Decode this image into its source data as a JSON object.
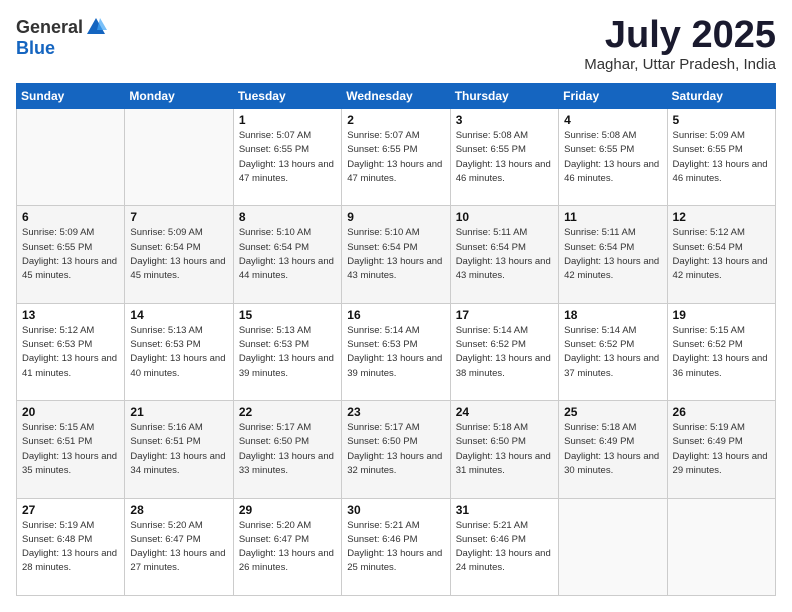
{
  "logo": {
    "general": "General",
    "blue": "Blue"
  },
  "title": "July 2025",
  "location": "Maghar, Uttar Pradesh, India",
  "headers": [
    "Sunday",
    "Monday",
    "Tuesday",
    "Wednesday",
    "Thursday",
    "Friday",
    "Saturday"
  ],
  "weeks": [
    [
      {
        "day": "",
        "sunrise": "",
        "sunset": "",
        "daylight": ""
      },
      {
        "day": "",
        "sunrise": "",
        "sunset": "",
        "daylight": ""
      },
      {
        "day": "1",
        "sunrise": "Sunrise: 5:07 AM",
        "sunset": "Sunset: 6:55 PM",
        "daylight": "Daylight: 13 hours and 47 minutes."
      },
      {
        "day": "2",
        "sunrise": "Sunrise: 5:07 AM",
        "sunset": "Sunset: 6:55 PM",
        "daylight": "Daylight: 13 hours and 47 minutes."
      },
      {
        "day": "3",
        "sunrise": "Sunrise: 5:08 AM",
        "sunset": "Sunset: 6:55 PM",
        "daylight": "Daylight: 13 hours and 46 minutes."
      },
      {
        "day": "4",
        "sunrise": "Sunrise: 5:08 AM",
        "sunset": "Sunset: 6:55 PM",
        "daylight": "Daylight: 13 hours and 46 minutes."
      },
      {
        "day": "5",
        "sunrise": "Sunrise: 5:09 AM",
        "sunset": "Sunset: 6:55 PM",
        "daylight": "Daylight: 13 hours and 46 minutes."
      }
    ],
    [
      {
        "day": "6",
        "sunrise": "Sunrise: 5:09 AM",
        "sunset": "Sunset: 6:55 PM",
        "daylight": "Daylight: 13 hours and 45 minutes."
      },
      {
        "day": "7",
        "sunrise": "Sunrise: 5:09 AM",
        "sunset": "Sunset: 6:54 PM",
        "daylight": "Daylight: 13 hours and 45 minutes."
      },
      {
        "day": "8",
        "sunrise": "Sunrise: 5:10 AM",
        "sunset": "Sunset: 6:54 PM",
        "daylight": "Daylight: 13 hours and 44 minutes."
      },
      {
        "day": "9",
        "sunrise": "Sunrise: 5:10 AM",
        "sunset": "Sunset: 6:54 PM",
        "daylight": "Daylight: 13 hours and 43 minutes."
      },
      {
        "day": "10",
        "sunrise": "Sunrise: 5:11 AM",
        "sunset": "Sunset: 6:54 PM",
        "daylight": "Daylight: 13 hours and 43 minutes."
      },
      {
        "day": "11",
        "sunrise": "Sunrise: 5:11 AM",
        "sunset": "Sunset: 6:54 PM",
        "daylight": "Daylight: 13 hours and 42 minutes."
      },
      {
        "day": "12",
        "sunrise": "Sunrise: 5:12 AM",
        "sunset": "Sunset: 6:54 PM",
        "daylight": "Daylight: 13 hours and 42 minutes."
      }
    ],
    [
      {
        "day": "13",
        "sunrise": "Sunrise: 5:12 AM",
        "sunset": "Sunset: 6:53 PM",
        "daylight": "Daylight: 13 hours and 41 minutes."
      },
      {
        "day": "14",
        "sunrise": "Sunrise: 5:13 AM",
        "sunset": "Sunset: 6:53 PM",
        "daylight": "Daylight: 13 hours and 40 minutes."
      },
      {
        "day": "15",
        "sunrise": "Sunrise: 5:13 AM",
        "sunset": "Sunset: 6:53 PM",
        "daylight": "Daylight: 13 hours and 39 minutes."
      },
      {
        "day": "16",
        "sunrise": "Sunrise: 5:14 AM",
        "sunset": "Sunset: 6:53 PM",
        "daylight": "Daylight: 13 hours and 39 minutes."
      },
      {
        "day": "17",
        "sunrise": "Sunrise: 5:14 AM",
        "sunset": "Sunset: 6:52 PM",
        "daylight": "Daylight: 13 hours and 38 minutes."
      },
      {
        "day": "18",
        "sunrise": "Sunrise: 5:14 AM",
        "sunset": "Sunset: 6:52 PM",
        "daylight": "Daylight: 13 hours and 37 minutes."
      },
      {
        "day": "19",
        "sunrise": "Sunrise: 5:15 AM",
        "sunset": "Sunset: 6:52 PM",
        "daylight": "Daylight: 13 hours and 36 minutes."
      }
    ],
    [
      {
        "day": "20",
        "sunrise": "Sunrise: 5:15 AM",
        "sunset": "Sunset: 6:51 PM",
        "daylight": "Daylight: 13 hours and 35 minutes."
      },
      {
        "day": "21",
        "sunrise": "Sunrise: 5:16 AM",
        "sunset": "Sunset: 6:51 PM",
        "daylight": "Daylight: 13 hours and 34 minutes."
      },
      {
        "day": "22",
        "sunrise": "Sunrise: 5:17 AM",
        "sunset": "Sunset: 6:50 PM",
        "daylight": "Daylight: 13 hours and 33 minutes."
      },
      {
        "day": "23",
        "sunrise": "Sunrise: 5:17 AM",
        "sunset": "Sunset: 6:50 PM",
        "daylight": "Daylight: 13 hours and 32 minutes."
      },
      {
        "day": "24",
        "sunrise": "Sunrise: 5:18 AM",
        "sunset": "Sunset: 6:50 PM",
        "daylight": "Daylight: 13 hours and 31 minutes."
      },
      {
        "day": "25",
        "sunrise": "Sunrise: 5:18 AM",
        "sunset": "Sunset: 6:49 PM",
        "daylight": "Daylight: 13 hours and 30 minutes."
      },
      {
        "day": "26",
        "sunrise": "Sunrise: 5:19 AM",
        "sunset": "Sunset: 6:49 PM",
        "daylight": "Daylight: 13 hours and 29 minutes."
      }
    ],
    [
      {
        "day": "27",
        "sunrise": "Sunrise: 5:19 AM",
        "sunset": "Sunset: 6:48 PM",
        "daylight": "Daylight: 13 hours and 28 minutes."
      },
      {
        "day": "28",
        "sunrise": "Sunrise: 5:20 AM",
        "sunset": "Sunset: 6:47 PM",
        "daylight": "Daylight: 13 hours and 27 minutes."
      },
      {
        "day": "29",
        "sunrise": "Sunrise: 5:20 AM",
        "sunset": "Sunset: 6:47 PM",
        "daylight": "Daylight: 13 hours and 26 minutes."
      },
      {
        "day": "30",
        "sunrise": "Sunrise: 5:21 AM",
        "sunset": "Sunset: 6:46 PM",
        "daylight": "Daylight: 13 hours and 25 minutes."
      },
      {
        "day": "31",
        "sunrise": "Sunrise: 5:21 AM",
        "sunset": "Sunset: 6:46 PM",
        "daylight": "Daylight: 13 hours and 24 minutes."
      },
      {
        "day": "",
        "sunrise": "",
        "sunset": "",
        "daylight": ""
      },
      {
        "day": "",
        "sunrise": "",
        "sunset": "",
        "daylight": ""
      }
    ]
  ]
}
